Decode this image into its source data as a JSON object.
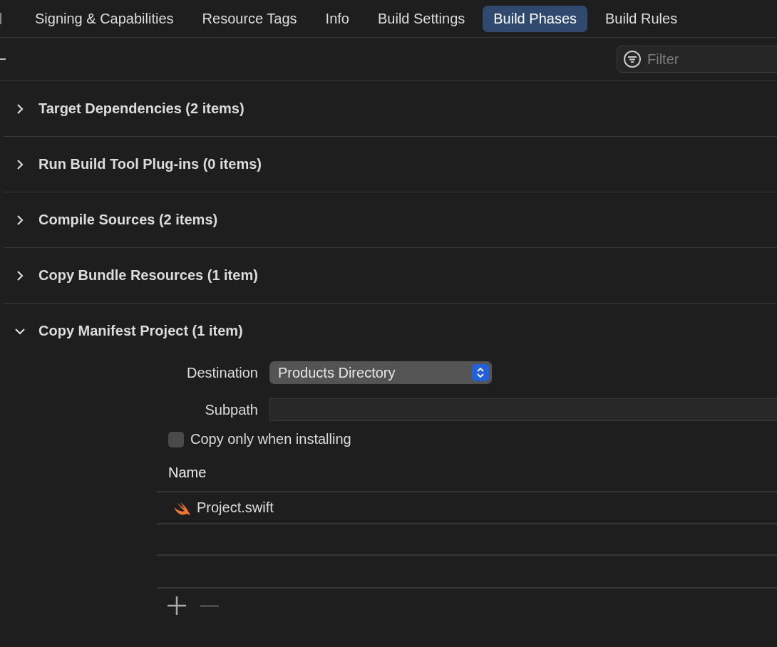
{
  "tabs": [
    {
      "label": "Signing & Capabilities",
      "selected": false
    },
    {
      "label": "Resource Tags",
      "selected": false
    },
    {
      "label": "Info",
      "selected": false
    },
    {
      "label": "Build Settings",
      "selected": false
    },
    {
      "label": "Build Phases",
      "selected": true
    },
    {
      "label": "Build Rules",
      "selected": false
    }
  ],
  "filter": {
    "placeholder": "Filter"
  },
  "phases": [
    {
      "title": "Target Dependencies (2 items)",
      "expanded": false
    },
    {
      "title": "Run Build Tool Plug-ins (0 items)",
      "expanded": false
    },
    {
      "title": "Compile Sources (2 items)",
      "expanded": false
    },
    {
      "title": "Copy Bundle Resources (1 item)",
      "expanded": false
    },
    {
      "title": "Copy Manifest Project (1 item)",
      "expanded": true
    }
  ],
  "copy_phase": {
    "destination_label": "Destination",
    "destination": "Products Directory",
    "subpath_label": "Subpath",
    "copy_only": {
      "label": "Copy only when installing",
      "checked": false
    },
    "column": "Name",
    "files": [
      "Project.swift"
    ],
    "remove_disabled": true
  }
}
